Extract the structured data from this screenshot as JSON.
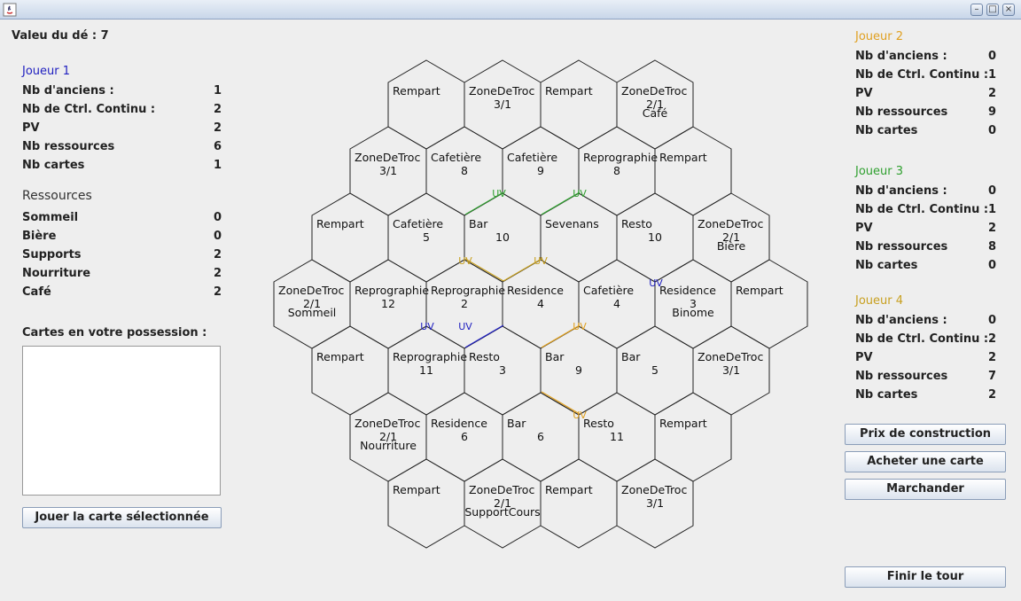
{
  "window": {
    "controls": [
      "minimize-icon",
      "maximize-icon",
      "close-icon"
    ]
  },
  "dice": {
    "label": "Valeu du dé : 7"
  },
  "player1": {
    "name": "Joueur 1",
    "color": "#2020c0",
    "stats": [
      {
        "label": "Nb d'anciens :",
        "value": "1"
      },
      {
        "label": "Nb de Ctrl. Continu :",
        "value": "2"
      },
      {
        "label": "PV",
        "value": "2"
      },
      {
        "label": "Nb ressources",
        "value": "6"
      },
      {
        "label": "Nb cartes",
        "value": "1"
      }
    ],
    "resources_title": "Ressources",
    "resources": [
      {
        "label": "Sommeil",
        "value": "0"
      },
      {
        "label": "Bière",
        "value": "0"
      },
      {
        "label": "Supports",
        "value": "2"
      },
      {
        "label": "Nourriture",
        "value": "2"
      },
      {
        "label": "Café",
        "value": "2"
      }
    ],
    "cards_title": "Cartes en votre possession :",
    "play_card_label": "Jouer la carte sélectionnée"
  },
  "opponents": [
    {
      "name": "Joueur 2",
      "color": "#e0a020",
      "stats": [
        {
          "label": "Nb d'anciens :",
          "value": "0"
        },
        {
          "label": "Nb de Ctrl. Continu :",
          "value": "1"
        },
        {
          "label": "PV",
          "value": "2"
        },
        {
          "label": "Nb ressources",
          "value": "9"
        },
        {
          "label": "Nb cartes",
          "value": "0"
        }
      ]
    },
    {
      "name": "Joueur 3",
      "color": "#30a030",
      "stats": [
        {
          "label": "Nb d'anciens :",
          "value": "0"
        },
        {
          "label": "Nb de Ctrl. Continu :",
          "value": "1"
        },
        {
          "label": "PV",
          "value": "2"
        },
        {
          "label": "Nb ressources",
          "value": "8"
        },
        {
          "label": "Nb cartes",
          "value": "0"
        }
      ]
    },
    {
      "name": "Joueur 4",
      "color": "#c8a020",
      "stats": [
        {
          "label": "Nb d'anciens :",
          "value": "0"
        },
        {
          "label": "Nb de Ctrl. Continu :",
          "value": "2"
        },
        {
          "label": "PV",
          "value": "2"
        },
        {
          "label": "Nb ressources",
          "value": "7"
        },
        {
          "label": "Nb cartes",
          "value": "2"
        }
      ]
    }
  ],
  "actions": {
    "build_price": "Prix de construction",
    "buy_card": "Acheter une carte",
    "trade": "Marchander",
    "end_turn": "Finir le tour"
  },
  "board": {
    "rows": [
      [
        [
          "Rempart"
        ],
        [
          "ZoneDeTroc",
          "3/1"
        ],
        [
          "Rempart"
        ],
        [
          "ZoneDeTroc",
          "2/1",
          "Café"
        ]
      ],
      [
        [
          "ZoneDeTroc",
          "3/1"
        ],
        [
          "Cafetière",
          "8"
        ],
        [
          "Cafetière",
          "9"
        ],
        [
          "Reprographie",
          "8"
        ],
        [
          "Rempart"
        ]
      ],
      [
        [
          "Rempart"
        ],
        [
          "Cafetière",
          "5"
        ],
        [
          "Bar",
          "10"
        ],
        [
          "Sevenans"
        ],
        [
          "Resto",
          "10"
        ],
        [
          "ZoneDeTroc",
          "2/1",
          "Bière"
        ]
      ],
      [
        [
          "ZoneDeTroc",
          "2/1",
          "Sommeil"
        ],
        [
          "Reprographie",
          "12"
        ],
        [
          "Reprographie",
          "2"
        ],
        [
          "Residence",
          "4"
        ],
        [
          "Cafetière",
          "4"
        ],
        [
          "Residence",
          "3",
          "Binome"
        ],
        [
          "Rempart"
        ]
      ],
      [
        [
          "Rempart"
        ],
        [
          "Reprographie",
          "11"
        ],
        [
          "Resto",
          "3"
        ],
        [
          "Bar",
          "9"
        ],
        [
          "Bar",
          "5"
        ],
        [
          "ZoneDeTroc",
          "3/1"
        ]
      ],
      [
        [
          "ZoneDeTroc",
          "2/1",
          "Nourriture"
        ],
        [
          "Residence",
          "6"
        ],
        [
          "Bar",
          "6"
        ],
        [
          "Resto",
          "11"
        ],
        [
          "Rempart"
        ]
      ],
      [
        [
          "Rempart"
        ],
        [
          "ZoneDeTroc",
          "2/1",
          "SupportCours"
        ],
        [
          "Rempart"
        ],
        [
          "ZoneDeTroc",
          "3/1"
        ]
      ]
    ],
    "uv_label": "UV",
    "roads": [
      {
        "color": "#30a030",
        "label": "UV"
      },
      {
        "color": "#30a030",
        "label": "UV"
      },
      {
        "color": "#c8a020",
        "label": "UV"
      },
      {
        "color": "#c8a020",
        "label": "UV"
      },
      {
        "color": "#2020c0",
        "label": "UV"
      },
      {
        "color": "#2020c0",
        "label": "UV"
      },
      {
        "color": "#e0a020",
        "label": "UV"
      },
      {
        "color": "#e0a020",
        "label": "UV"
      }
    ]
  }
}
